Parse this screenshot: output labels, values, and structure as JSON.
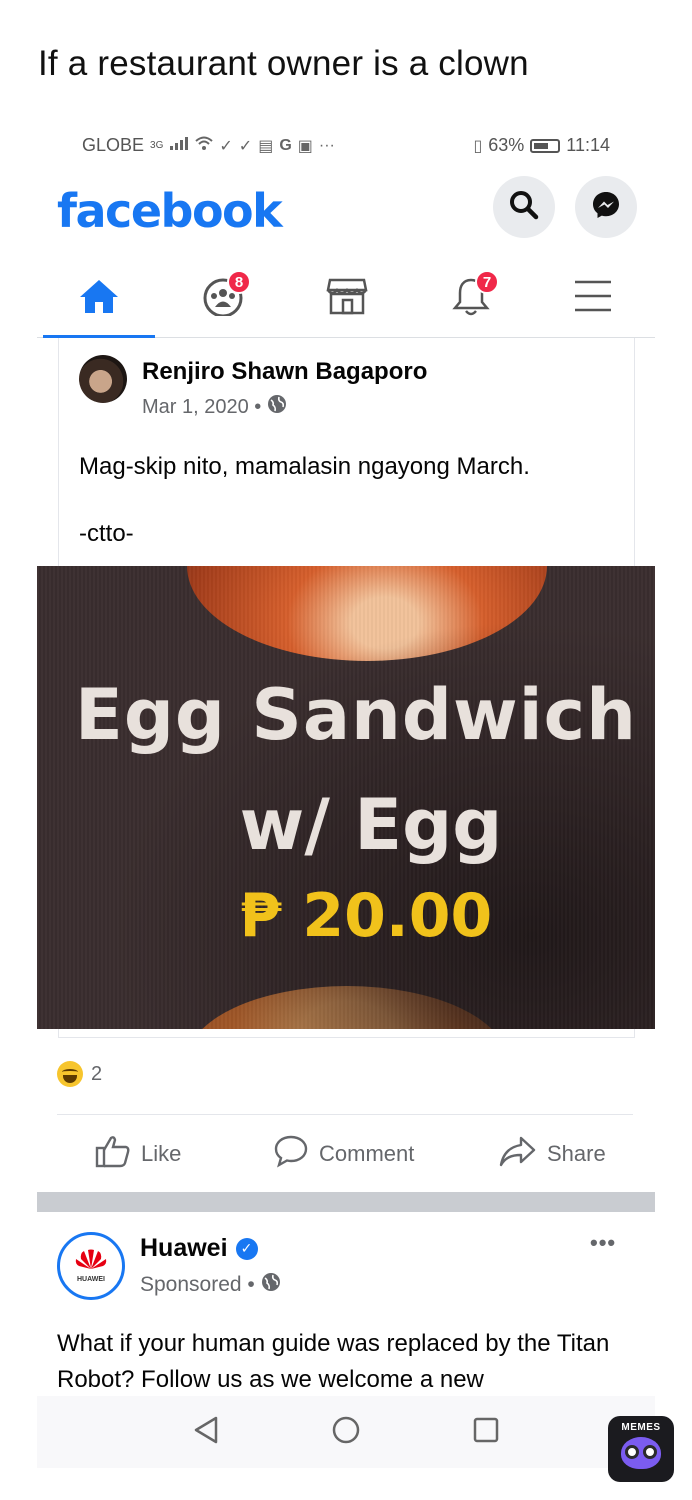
{
  "meme": {
    "caption": "If a restaurant owner is a clown",
    "watermark": "MEMES"
  },
  "status_bar": {
    "carrier": "GLOBE",
    "network": "3G",
    "battery": "63%",
    "time": "11:14"
  },
  "header": {
    "logo": "facebook",
    "icons": [
      "search-icon",
      "messenger-icon"
    ],
    "brand_color": "#1877f2"
  },
  "nav": {
    "tabs": [
      {
        "icon": "home-icon",
        "active": true
      },
      {
        "icon": "groups-icon",
        "badge": "8"
      },
      {
        "icon": "marketplace-icon"
      },
      {
        "icon": "bell-icon",
        "badge": "7"
      },
      {
        "icon": "menu-icon"
      }
    ]
  },
  "post": {
    "author": "Renjiro Shawn Bagaporo",
    "date": "Mar 1, 2020 •",
    "privacy_icon": "globe-icon",
    "text_line1": "Mag-skip nito, mamalasin ngayong March.",
    "text_line2": "-ctto-",
    "image_text": {
      "line1": "Egg Sandwich",
      "line2": "w/ Egg",
      "price": "₱ 20.00"
    },
    "reaction_count": "2",
    "reaction_icon": "haha-icon",
    "actions": {
      "like": "Like",
      "comment": "Comment",
      "share": "Share"
    }
  },
  "sponsored": {
    "name": "Huawei",
    "meta": "Sponsored •",
    "avatar_text": "HUAWEI",
    "text": "What if your human guide was replaced by the Titan Robot? Follow us as we welcome a new"
  },
  "android_nav": [
    "back-icon",
    "home-circle-icon",
    "recents-icon"
  ]
}
